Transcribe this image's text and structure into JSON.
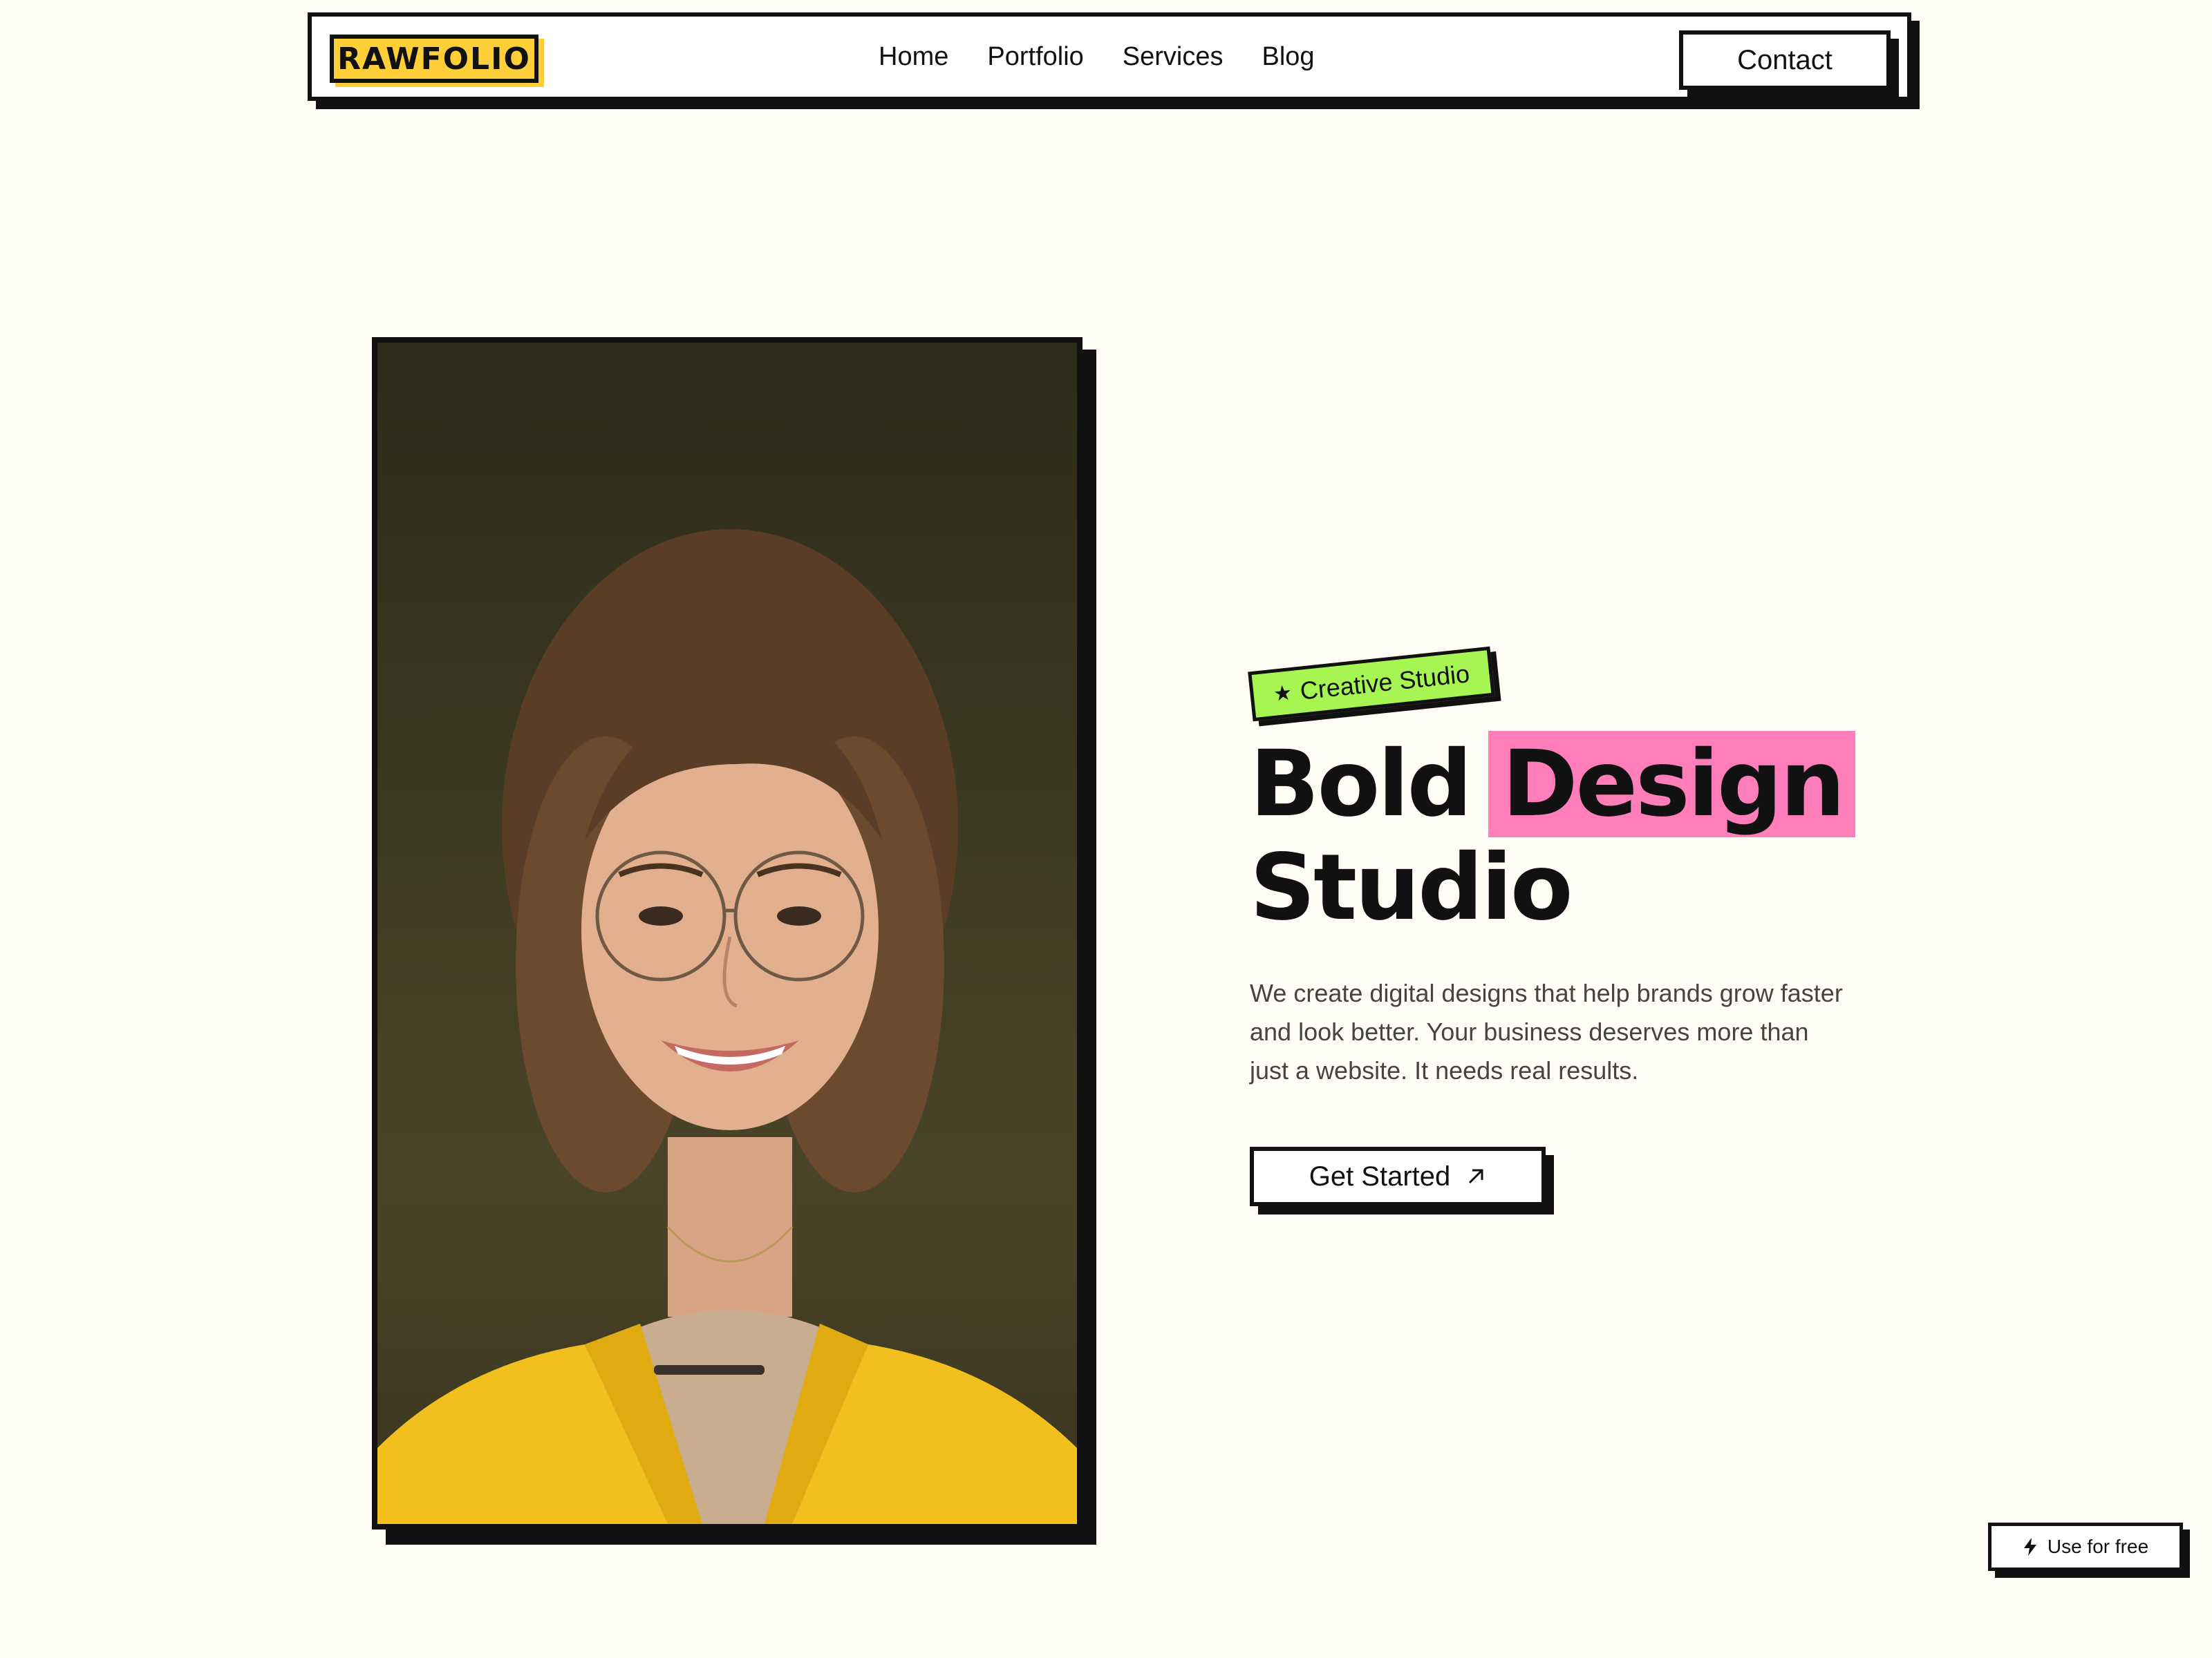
{
  "nav": {
    "logo": "RAWFOLIO",
    "links": [
      "Home",
      "Portfolio",
      "Services",
      "Blog"
    ],
    "contact_label": "Contact"
  },
  "hero": {
    "badge": "Creative Studio",
    "badge_icon": "star-icon",
    "title_word1": "Bold",
    "title_highlight": "Design",
    "title_word2": "Studio",
    "description": "We create digital designs that help brands grow faster and look better. Your business deserves more than just a website. It needs real results.",
    "cta_label": "Get Started",
    "cta_icon": "arrow-up-right-icon"
  },
  "floating": {
    "label": "Use for free",
    "icon": "bolt-icon"
  },
  "colors": {
    "background": "#fffdf5",
    "logo_bg": "#ffcf3a",
    "badge_bg": "#a6f552",
    "highlight": "#ff7eb9",
    "ink": "#111111"
  }
}
